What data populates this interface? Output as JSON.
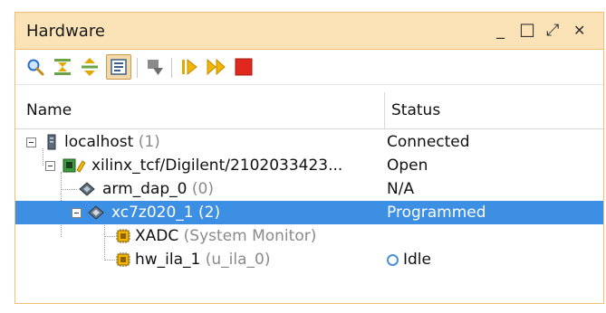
{
  "panel": {
    "title": "Hardware",
    "controls": {
      "minimize": "_",
      "maximize": "☐",
      "restore": "⤢",
      "close": "✕"
    }
  },
  "toolbar": {
    "buttons": [
      {
        "icon": "search-icon"
      },
      {
        "icon": "collapse-all-icon"
      },
      {
        "icon": "expand-all-icon"
      },
      {
        "icon": "properties-icon",
        "active": true
      },
      {
        "icon": "export-icon",
        "disabled": true
      },
      {
        "icon": "run-trigger-icon"
      },
      {
        "icon": "run-trigger-immediate-icon"
      },
      {
        "icon": "stop-trigger-icon"
      }
    ]
  },
  "table": {
    "columns": [
      "Name",
      "Status"
    ],
    "rows": [
      {
        "name": "localhost",
        "suffix": "(1)",
        "status": "Connected"
      },
      {
        "name": "xilinx_tcf/Digilent/2102033423...",
        "suffix": "",
        "status": "Open"
      },
      {
        "name": "arm_dap_0",
        "suffix": "(0)",
        "status": "N/A"
      },
      {
        "name": "xc7z020_1",
        "suffix": "(2)",
        "status": "Programmed",
        "selected": true
      },
      {
        "name": "XADC",
        "suffix": "(System Monitor)",
        "status": ""
      },
      {
        "name": "hw_ila_1",
        "suffix": "(u_ila_0)",
        "status": "Idle"
      }
    ]
  },
  "colors": {
    "titlebar_bg": "#fbe3b7",
    "selection": "#3c8fe3",
    "idle_ring": "#4a90d9",
    "stop_red": "#e0281e",
    "run_yellow": "#f2b600"
  }
}
